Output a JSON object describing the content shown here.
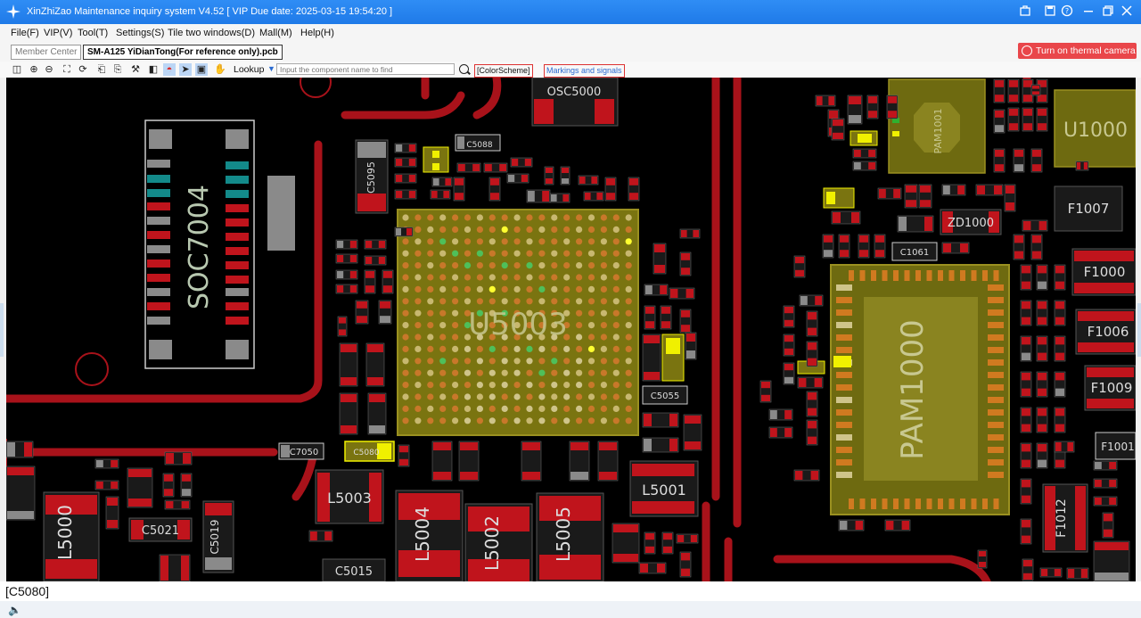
{
  "window": {
    "title": "XinZhiZao Maintenance inquiry system V4.52 [ VIP Due date: 2025-03-15 19:54:20 ]",
    "buttons": [
      "bag-icon",
      "save-icon",
      "help-icon",
      "minimize-icon",
      "restore-icon",
      "close-icon"
    ]
  },
  "menu": [
    "File(F)",
    "VIP(V)",
    "Tool(T)",
    "Settings(S)",
    "Tile two windows(D)",
    "Mall(M)",
    "Help(H)"
  ],
  "tabs": {
    "member": "Member Center",
    "active": "SM-A125 YiDianTong(For reference only).pcb"
  },
  "thermal_button": "Turn on thermal camera",
  "toolbar": {
    "lookup_label": "Lookup",
    "search_placeholder": "Input the component name to find",
    "color_scheme": "[ColorScheme]",
    "markings": "Markings and signals"
  },
  "board": {
    "big_labels": [
      "SOC7004",
      "U5003",
      "PAM1000",
      "U1000",
      "OSC5000",
      "L5000",
      "L5003",
      "L5004",
      "L5002",
      "L5005",
      "L5001",
      "F1007",
      "F1000",
      "F1006",
      "F1009",
      "F1001",
      "F1012",
      "ZD1000",
      "C5021",
      "C5019",
      "C5015",
      "C5088",
      "C5095",
      "C5055",
      "C7050",
      "C5080",
      "C1061",
      "PAM1001"
    ],
    "colors": {
      "board": "#000000",
      "trace": "#a8121a",
      "pad_red": "#c0141c",
      "chip": "#7a7410",
      "highlight": "#f0f000",
      "grey": "#8a8a8a",
      "teal": "#138a8a"
    }
  },
  "status": {
    "selected": "[C5080]"
  }
}
